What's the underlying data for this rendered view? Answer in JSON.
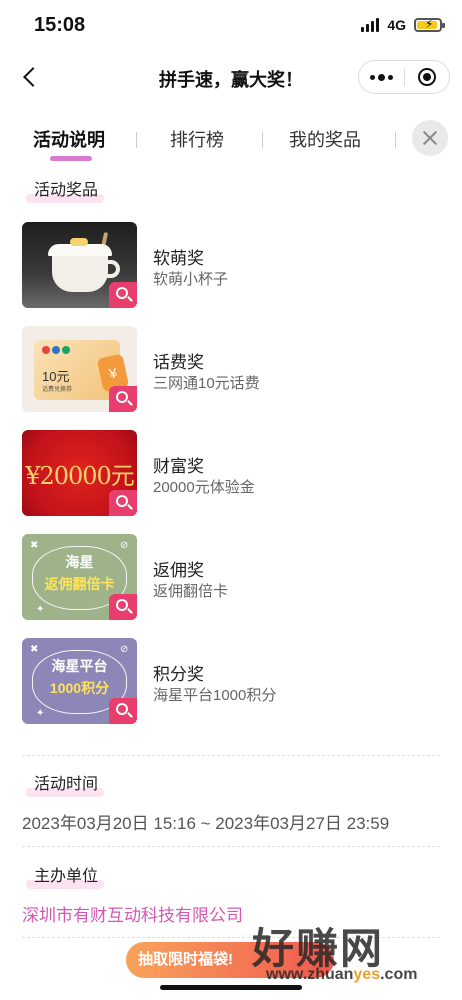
{
  "status_bar": {
    "time": "15:08",
    "network": "4G"
  },
  "nav": {
    "title": "拼手速，赢大奖！"
  },
  "tabs": [
    {
      "label": "活动说明",
      "active": true
    },
    {
      "label": "排行榜",
      "active": false
    },
    {
      "label": "我的奖品",
      "active": false
    }
  ],
  "prizes_section": {
    "title": "活动奖品"
  },
  "prizes": [
    {
      "name": "软萌奖",
      "desc": "软萌小杯子"
    },
    {
      "name": "话费奖",
      "desc": "三网通10元话费",
      "thumb_value": "10元",
      "thumb_sub": "话费兑换券",
      "thumb_coin": "¥"
    },
    {
      "name": "财富奖",
      "desc": "20000元体验金",
      "thumb_text": "¥20000元"
    },
    {
      "name": "返佣奖",
      "desc": "返佣翻倍卡",
      "thumb_line1": "海星",
      "thumb_line2": "返佣翻倍卡"
    },
    {
      "name": "积分奖",
      "desc": "海星平台1000积分",
      "thumb_line1": "海星平台",
      "thumb_line2": "1000积分"
    }
  ],
  "time_section": {
    "title": "活动时间",
    "value": "2023年03月20日 15:16 ~ 2023年03月27日 23:59"
  },
  "org_section": {
    "title": "主办单位",
    "value": "深圳市有财互动科技有限公司"
  },
  "float_button": {
    "label": "抽取限时福袋!"
  },
  "watermark": {
    "main": "好赚网",
    "sub_pre": "www.zhuan",
    "sub_hi": "yes",
    "sub_post": ".com"
  },
  "colors": {
    "accent_pink": "#d458b4",
    "zoom_badge": "#e83e6d",
    "tab_underline": "#d77bd1"
  }
}
